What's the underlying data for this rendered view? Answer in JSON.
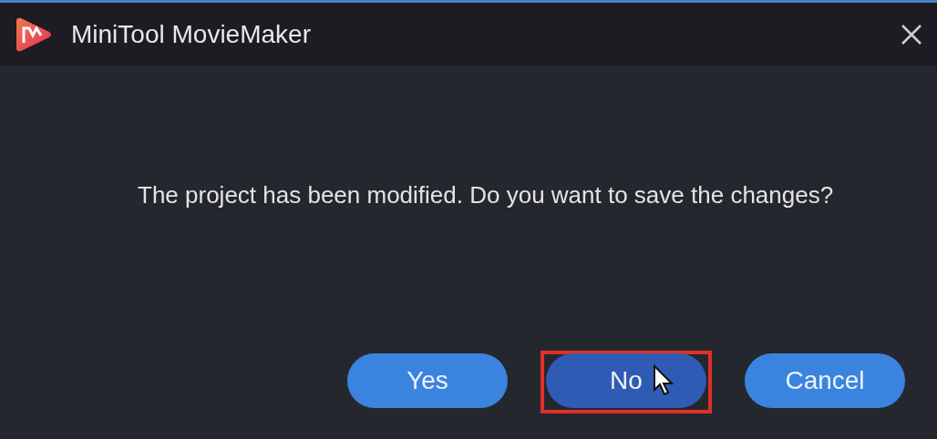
{
  "window": {
    "title": "MiniTool MovieMaker"
  },
  "message": "The project has been modified. Do you want to save the changes?",
  "buttons": [
    {
      "label": "Yes",
      "hovered": false,
      "highlighted": false
    },
    {
      "label": "No",
      "hovered": true,
      "highlighted": true
    },
    {
      "label": "Cancel",
      "hovered": false,
      "highlighted": false
    }
  ]
}
